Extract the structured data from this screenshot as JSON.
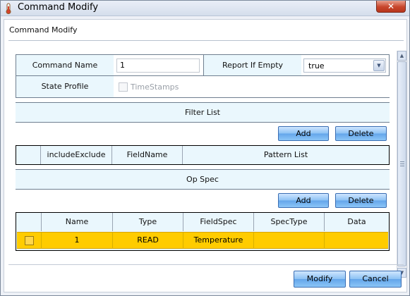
{
  "window": {
    "title": "Command Modify",
    "close_glyph": "✕"
  },
  "dialog": {
    "header_title": "Command Modify"
  },
  "form": {
    "command_name_label": "Command Name",
    "command_name_value": "1",
    "report_if_empty_label": "Report If Empty",
    "report_if_empty_value": "true",
    "state_profile_label": "State Profile",
    "timestamps_label": "TimeStamps",
    "timestamps_checked": false
  },
  "filter_list": {
    "title": "Filter List",
    "add_label": "Add",
    "delete_label": "Delete",
    "columns": [
      "",
      "includeExclude",
      "FieldName",
      "Pattern List"
    ]
  },
  "op_spec": {
    "title": "Op Spec",
    "add_label": "Add",
    "delete_label": "Delete",
    "columns": [
      "",
      "Name",
      "Type",
      "FieldSpec",
      "SpecType",
      "Data"
    ],
    "rows": [
      {
        "selected": false,
        "name": "1",
        "type": "READ",
        "field_spec": "Temperature",
        "spec_type": "",
        "data": ""
      }
    ]
  },
  "footer": {
    "modify_label": "Modify",
    "cancel_label": "Cancel"
  },
  "colors": {
    "selected_row": "#ffcc00",
    "header_bg": "#eaf7fd",
    "button": "#8cc1f4"
  },
  "icons": {
    "app": "thermometer-icon",
    "dropdown": "chevron-down-icon",
    "close": "close-icon"
  }
}
